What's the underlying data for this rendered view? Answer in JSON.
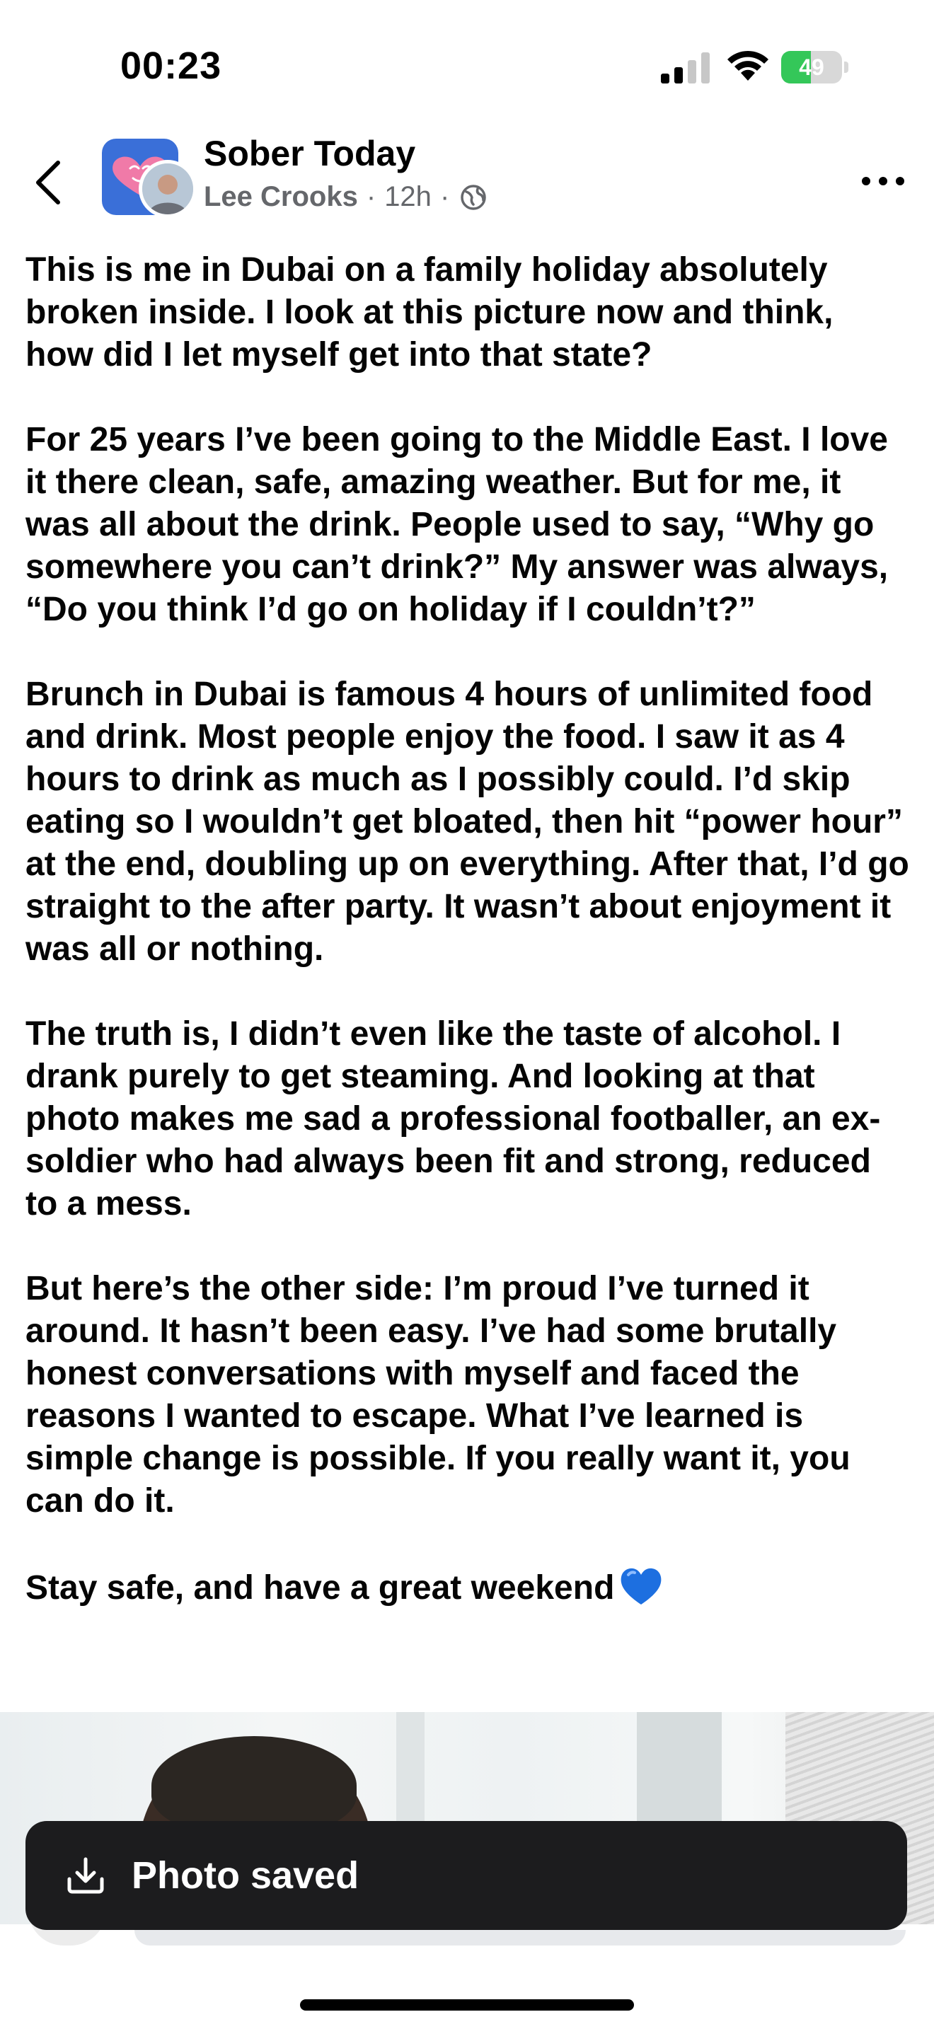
{
  "status_bar": {
    "time": "00:23",
    "battery_text": "49",
    "battery_level": 0.49,
    "battery_color": "#34c759"
  },
  "header": {
    "back_icon": "chevron-left-icon",
    "group_name": "Sober Today",
    "author": "Lee Crooks",
    "separator": "·",
    "time_ago": "12h",
    "audience_icon": "globe-icon",
    "more_icon": "more-horizontal-icon"
  },
  "post": {
    "paragraphs": [
      "This is me in Dubai on a family holiday absolutely broken inside. I look at this picture now and think, how did I let myself get into that state?",
      "For 25 years I’ve been going to the Middle East. I love it there clean, safe, amazing weather. But for me, it was all about the drink. People used to say, “Why go somewhere you can’t drink?” My answer was always, “Do you think I’d go on holiday if I couldn’t?”",
      "Brunch in Dubai is famous 4 hours of unlimited food and drink. Most people enjoy the food. I saw it as 4 hours to drink as much as I possibly could. I’d skip eating so I wouldn’t get bloated, then hit “power hour” at the end, doubling up on everything. After that, I’d go straight to the after party. It wasn’t about enjoyment it was all or nothing.",
      "The truth is, I didn’t even like the taste of alcohol. I drank purely to get steaming. And looking at that photo makes me sad a professional footballer, an ex-soldier who had always been fit and strong, reduced to a mess.",
      "But here’s the other side: I’m proud I’ve turned it around. It hasn’t been easy. I’ve had some brutally honest conversations with myself and faced the reasons I wanted to escape. What I’ve learned is simple change is possible. If you really want it, you can do it.",
      "Stay safe, and have a great weekend"
    ],
    "closing_emoji": "blue-heart-icon"
  },
  "toast": {
    "icon": "download-icon",
    "label": "Photo saved"
  },
  "colors": {
    "accent_blue": "#1d6fe0",
    "secondary_text": "#65676b",
    "toast_background": "#1c1c1e"
  }
}
